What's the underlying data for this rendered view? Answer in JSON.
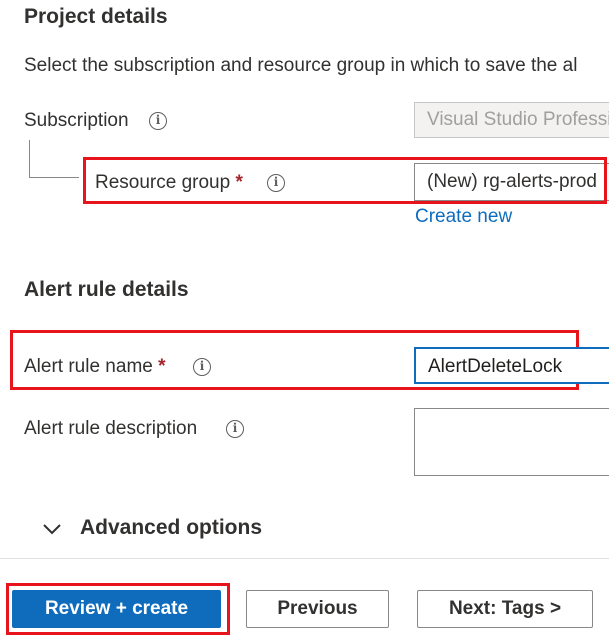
{
  "project": {
    "heading": "Project details",
    "description": "Select the subscription and resource group in which to save the al",
    "subscription_label": "Subscription",
    "subscription_value": "Visual Studio Professi",
    "resource_group_label": "Resource group",
    "resource_group_required": "*",
    "resource_group_value": "(New) rg-alerts-prod",
    "create_new": "Create new"
  },
  "alert": {
    "heading": "Alert rule details",
    "name_label": "Alert rule name",
    "name_required": "*",
    "name_value": "AlertDeleteLock",
    "description_label": "Alert rule description",
    "description_value": ""
  },
  "advanced": {
    "label": "Advanced options"
  },
  "footer": {
    "review_create": "Review + create",
    "previous": "Previous",
    "next": "Next: Tags >"
  },
  "icons": {
    "info": "i",
    "chevron": "chevron-down-icon"
  },
  "colors": {
    "accent": "#0f6cbd",
    "highlight": "#e8141c",
    "required": "#a4262c"
  }
}
